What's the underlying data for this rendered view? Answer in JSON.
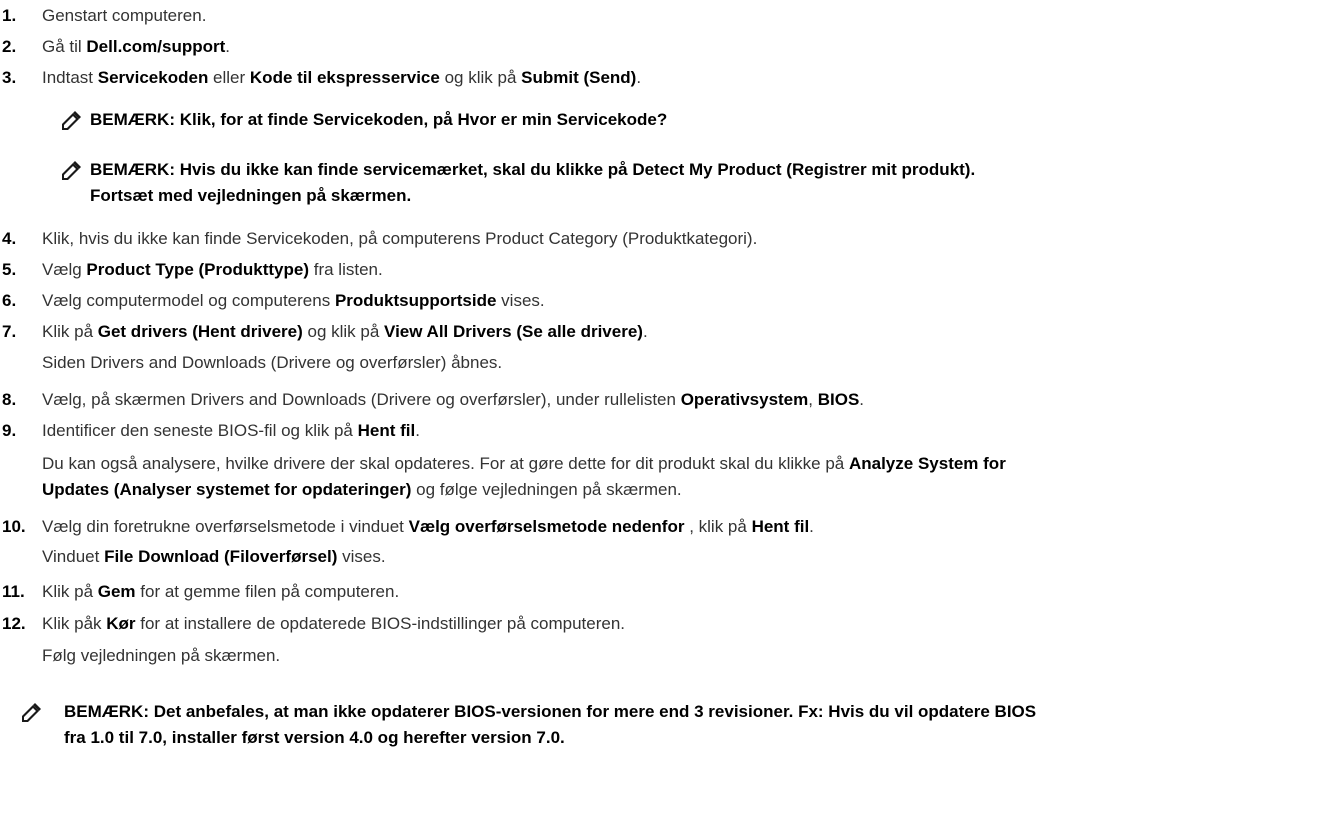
{
  "steps": {
    "s1": {
      "num": "1.",
      "a": "Genstart computeren."
    },
    "s2": {
      "num": "2.",
      "a": "Gå til ",
      "b": "Dell.com/support",
      "c": "."
    },
    "s3": {
      "num": "3.",
      "a": "Indtast ",
      "b": "Servicekoden",
      "c": " eller ",
      "d": "Kode til ekspresservice",
      "e": " og klik på ",
      "f": "Submit (Send)",
      "g": "."
    },
    "s4": {
      "num": "4.",
      "a": "Klik, hvis du ikke kan finde Servicekoden, på computerens Product Category (Produktkategori)."
    },
    "s5": {
      "num": "5.",
      "a": "Vælg ",
      "b": "Product Type (Produkttype)",
      "c": " fra listen."
    },
    "s6": {
      "num": "6.",
      "a": "Vælg computermodel og computerens ",
      "b": "Produktsupportside",
      "c": " vises."
    },
    "s7": {
      "num": "7.",
      "a": "Klik på ",
      "b": "Get drivers (Hent drivere)",
      "c": " og klik på ",
      "d": "View All Drivers (Se alle drivere)",
      "e": ".",
      "sub": "Siden Drivers and Downloads (Drivere og overførsler) åbnes."
    },
    "s8": {
      "num": "8.",
      "a": "Vælg, på skærmen Drivers and Downloads (Drivere og overførsler), under rullelisten ",
      "b": "Operativsystem",
      "c": ", ",
      "d": "BIOS",
      "e": "."
    },
    "s9": {
      "num": "9.",
      "a": "Identificer den seneste BIOS-fil og klik på ",
      "b": "Hent fil",
      "c": ".",
      "sub1a": "Du kan også analysere, hvilke drivere der skal opdateres. For at gøre dette for dit produkt skal du klikke på ",
      "sub1b": "Analyze System for",
      "sub2a": "Updates (Analyser systemet for opdateringer)",
      "sub2b": " og følge vejledningen på skærmen."
    },
    "s10": {
      "num": "10.",
      "a": "Vælg din foretrukne overførselsmetode i vinduet ",
      "b": "Vælg overførselsmetode nedenfor",
      "c": " , klik på ",
      "d": "Hent fil",
      "e": ".",
      "suba": "Vinduet ",
      "subb": "File Download (Filoverførsel)",
      "subc": " vises."
    },
    "s11": {
      "num": "11.",
      "a": "Klik på ",
      "b": "Gem",
      "c": " for at gemme filen på computeren."
    },
    "s12": {
      "num": "12.",
      "a": "Klik påk ",
      "b": "Kør",
      "c": " for at installere de opdaterede BIOS-indstillinger på computeren.",
      "sub": "Følg vejledningen på skærmen."
    }
  },
  "notes": {
    "n1": "BEMÆRK: Klik, for at finde Servicekoden, på Hvor er min Servicekode?",
    "n2_line1": "BEMÆRK: Hvis du ikke kan finde servicemærket, skal du klikke på Detect My Product (Registrer mit produkt).",
    "n2_line2": "Fortsæt med vejledningen på skærmen.",
    "n3_line1": "BEMÆRK: Det anbefales, at man ikke opdaterer BIOS-versionen for mere end 3 revisioner. Fx: Hvis du vil opdatere BIOS",
    "n3_line2": "fra 1.0 til 7.0, installer først version 4.0 og herefter version 7.0."
  },
  "icons": {
    "note": "pencil-note-icon"
  }
}
